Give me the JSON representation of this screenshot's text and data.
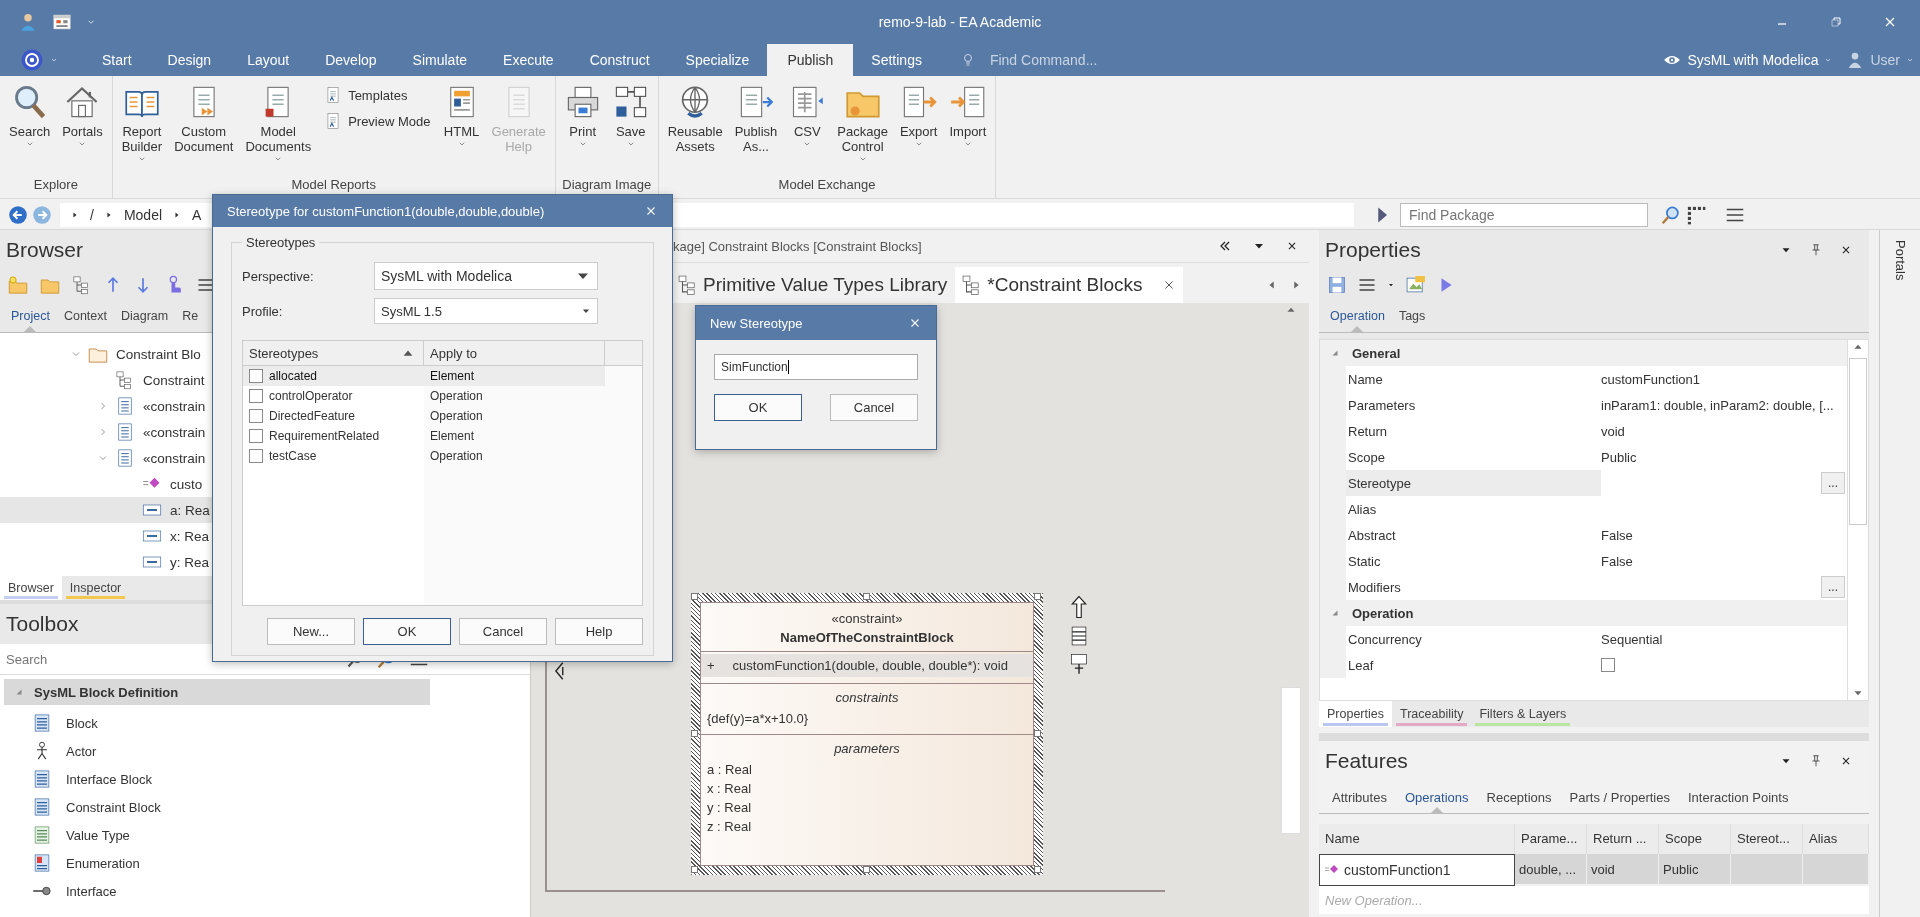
{
  "window": {
    "title": "remo-9-lab - EA Academic"
  },
  "menu_tabs": [
    {
      "label": "Start",
      "selected": false
    },
    {
      "label": "Design",
      "selected": false
    },
    {
      "label": "Layout",
      "selected": false
    },
    {
      "label": "Develop",
      "selected": false
    },
    {
      "label": "Simulate",
      "selected": false
    },
    {
      "label": "Execute",
      "selected": false
    },
    {
      "label": "Construct",
      "selected": false
    },
    {
      "label": "Specialize",
      "selected": false
    },
    {
      "label": "Publish",
      "selected": true
    },
    {
      "label": "Settings",
      "selected": false
    }
  ],
  "find_command": {
    "placeholder": "Find Command..."
  },
  "perspective": {
    "label": "SysML with Modelica"
  },
  "user": {
    "label": "User"
  },
  "ribbon": {
    "groups": [
      {
        "label": "Explore",
        "buttons": [
          {
            "kind": "large",
            "label": "Search",
            "dropdown": true,
            "disabled": false
          },
          {
            "kind": "large",
            "label": "Portals",
            "dropdown": true,
            "disabled": false
          }
        ]
      },
      {
        "label": "Model Reports",
        "buttons": [
          {
            "kind": "large",
            "label": "Report Builder",
            "dropdown": true,
            "disabled": false
          },
          {
            "kind": "large",
            "label": "Custom Document",
            "dropdown": false,
            "disabled": false
          },
          {
            "kind": "large",
            "label": "Model Documents",
            "dropdown": true,
            "disabled": false
          },
          {
            "kind": "stack",
            "items": [
              {
                "label": "Templates"
              },
              {
                "label": "Preview Mode"
              }
            ]
          },
          {
            "kind": "large",
            "label": "HTML",
            "dropdown": true,
            "disabled": false
          },
          {
            "kind": "large",
            "label": "Generate Help",
            "dropdown": false,
            "disabled": true
          }
        ]
      },
      {
        "label": "Diagram Image",
        "buttons": [
          {
            "kind": "large",
            "label": "Print",
            "dropdown": true,
            "disabled": false
          },
          {
            "kind": "large",
            "label": "Save",
            "dropdown": true,
            "disabled": false
          }
        ]
      },
      {
        "label": "Model Exchange",
        "buttons": [
          {
            "kind": "large",
            "label": "Reusable Assets",
            "dropdown": false,
            "disabled": false
          },
          {
            "kind": "large",
            "label": "Publish As...",
            "dropdown": false,
            "disabled": false
          },
          {
            "kind": "large",
            "label": "CSV",
            "dropdown": true,
            "disabled": false
          },
          {
            "kind": "large",
            "label": "Package Control",
            "dropdown": true,
            "disabled": false
          },
          {
            "kind": "large",
            "label": "Export",
            "dropdown": true,
            "disabled": false
          },
          {
            "kind": "large",
            "label": "Import",
            "dropdown": true,
            "disabled": false
          }
        ]
      }
    ]
  },
  "breadcrumb": [
    "/",
    "Model",
    "A"
  ],
  "find_package": {
    "placeholder": "Find Package"
  },
  "browser": {
    "title": "Browser",
    "tabs": [
      {
        "label": "Project",
        "selected": true
      },
      {
        "label": "Context",
        "selected": false
      },
      {
        "label": "Diagram",
        "selected": false
      },
      {
        "label": "Re",
        "selected": false
      }
    ],
    "tree": [
      {
        "label": "Constraint Blo",
        "kind": "package",
        "expanded": true,
        "selected": false,
        "children": [
          {
            "label": "Constraint",
            "kind": "diagram",
            "selected": false
          },
          {
            "label": "«constrain",
            "kind": "block",
            "expanded": false,
            "selected": false
          },
          {
            "label": "«constrain",
            "kind": "block",
            "expanded": false,
            "selected": false
          },
          {
            "label": "«constrain",
            "kind": "block",
            "expanded": true,
            "selected": false,
            "children": [
              {
                "label": "custo",
                "kind": "operation",
                "selected": false
              },
              {
                "label": "a: Rea",
                "kind": "attribute",
                "selected": true
              },
              {
                "label": "x: Rea",
                "kind": "attribute",
                "selected": false
              },
              {
                "label": "y: Rea",
                "kind": "attribute",
                "selected": false
              }
            ]
          }
        ]
      }
    ],
    "bottom_tabs": [
      {
        "label": "Browser",
        "selected": true,
        "color": "#c5cdf0"
      },
      {
        "label": "Inspector",
        "selected": false,
        "color": "#f2c94c"
      }
    ]
  },
  "toolbox": {
    "title": "Toolbox",
    "search": {
      "placeholder": "Search"
    },
    "section": {
      "label": "SysML Block Definition",
      "expanded": true
    },
    "items": [
      {
        "label": "Block",
        "kind": "block"
      },
      {
        "label": "Actor",
        "kind": "actor"
      },
      {
        "label": "Interface Block",
        "kind": "block"
      },
      {
        "label": "Constraint Block",
        "kind": "block"
      },
      {
        "label": "Value Type",
        "kind": "valuetype"
      },
      {
        "label": "Enumeration",
        "kind": "enumeration"
      },
      {
        "label": "Interface",
        "kind": "interface"
      }
    ]
  },
  "diagram": {
    "path": "kage] Constraint Blocks [Constraint Blocks]",
    "tabs": [
      {
        "label": "Primitive Value Types Library",
        "selected": false
      },
      {
        "label": "*Constraint Blocks",
        "selected": true
      }
    ],
    "block": {
      "selected": true,
      "stereotype": "«constraint»",
      "name": "NameOfTheConstraintBlock",
      "operations": [
        {
          "visibility": "+",
          "signature": "customFunction1(double, double, double*): void",
          "selected": true
        }
      ],
      "compartments": [
        {
          "title": "constraints",
          "lines": [
            "{def(y)=a*x+10.0}"
          ]
        },
        {
          "title": "parameters",
          "lines": [
            "a : Real",
            "x : Real",
            "y : Real",
            "z : Real"
          ]
        }
      ]
    }
  },
  "properties": {
    "title": "Properties",
    "tabs": [
      {
        "label": "Operation",
        "selected": true
      },
      {
        "label": "Tags",
        "selected": false
      }
    ],
    "sections": [
      {
        "label": "General",
        "expanded": true,
        "rows": [
          {
            "name": "Name",
            "kind": "text",
            "value": "customFunction1",
            "selected": false
          },
          {
            "name": "Parameters",
            "kind": "text",
            "value": "inParam1: double, inParam2: double, [...",
            "selected": false
          },
          {
            "name": "Return",
            "kind": "text",
            "value": "void",
            "selected": false
          },
          {
            "name": "Scope",
            "kind": "text",
            "value": "Public",
            "selected": false
          },
          {
            "name": "Stereotype",
            "kind": "button",
            "button": "...",
            "selected": true
          },
          {
            "name": "Alias",
            "kind": "text",
            "selected": false
          },
          {
            "name": "Abstract",
            "kind": "text",
            "value": "False",
            "selected": false
          },
          {
            "name": "Static",
            "kind": "text",
            "value": "False",
            "selected": false
          },
          {
            "name": "Modifiers",
            "kind": "button",
            "button": "...",
            "selected": false
          }
        ]
      },
      {
        "label": "Operation",
        "expanded": true,
        "rows": [
          {
            "name": "Concurrency",
            "kind": "text",
            "value": "Sequential",
            "selected": false
          },
          {
            "name": "Leaf",
            "kind": "checkbox",
            "checked": false,
            "selected": false
          }
        ]
      }
    ],
    "bottom_tabs": [
      {
        "label": "Properties",
        "selected": true,
        "color": "#b9c6f0"
      },
      {
        "label": "Traceability",
        "selected": false,
        "color": "#e4a9c4"
      },
      {
        "label": "Filters & Layers",
        "selected": false,
        "color": "#b8e6a0"
      }
    ]
  },
  "features": {
    "title": "Features",
    "tabs": [
      {
        "label": "Attributes",
        "selected": false
      },
      {
        "label": "Operations",
        "selected": true
      },
      {
        "label": "Receptions",
        "selected": false
      },
      {
        "label": "Parts / Properties",
        "selected": false
      },
      {
        "label": "Interaction Points",
        "selected": false
      }
    ],
    "columns": [
      "Name",
      "Parame...",
      "Return ...",
      "Scope",
      "Stereot...",
      "Alias"
    ],
    "rows": [
      {
        "cells": [
          "customFunction1",
          "double, ...",
          "void",
          "Public"
        ],
        "selected": true
      }
    ],
    "new_row": {
      "placeholder": "New Operation..."
    }
  },
  "portals": {
    "label": "Portals"
  },
  "stereotype_dialog": {
    "title": "Stereotype for customFunction1(double,double,double)",
    "group": "Stereotypes",
    "perspective": {
      "label": "Perspective:",
      "value": "SysML with Modelica"
    },
    "profile": {
      "label": "Profile:",
      "value": "SysML 1.5"
    },
    "columns": [
      {
        "label": "Stereotypes",
        "sorted": true
      },
      {
        "label": "Apply to",
        "sorted": false
      }
    ],
    "rows": [
      {
        "name": "allocated",
        "apply_to": "Element",
        "checked": false,
        "selected": true
      },
      {
        "name": "controlOperator",
        "apply_to": "Operation",
        "checked": false,
        "selected": false
      },
      {
        "name": "DirectedFeature",
        "apply_to": "Operation",
        "checked": false,
        "selected": false
      },
      {
        "name": "RequirementRelated",
        "apply_to": "Element",
        "checked": false,
        "selected": false
      },
      {
        "name": "testCase",
        "apply_to": "Operation",
        "checked": false,
        "selected": false
      }
    ],
    "buttons": [
      {
        "label": "New...",
        "default": false
      },
      {
        "label": "OK",
        "default": true
      },
      {
        "label": "Cancel",
        "default": false
      },
      {
        "label": "Help",
        "default": false
      }
    ]
  },
  "new_stereotype_dialog": {
    "title": "New Stereotype",
    "value": "SimFunction",
    "buttons": [
      {
        "label": "OK",
        "default": true
      },
      {
        "label": "Cancel",
        "default": false
      }
    ]
  }
}
